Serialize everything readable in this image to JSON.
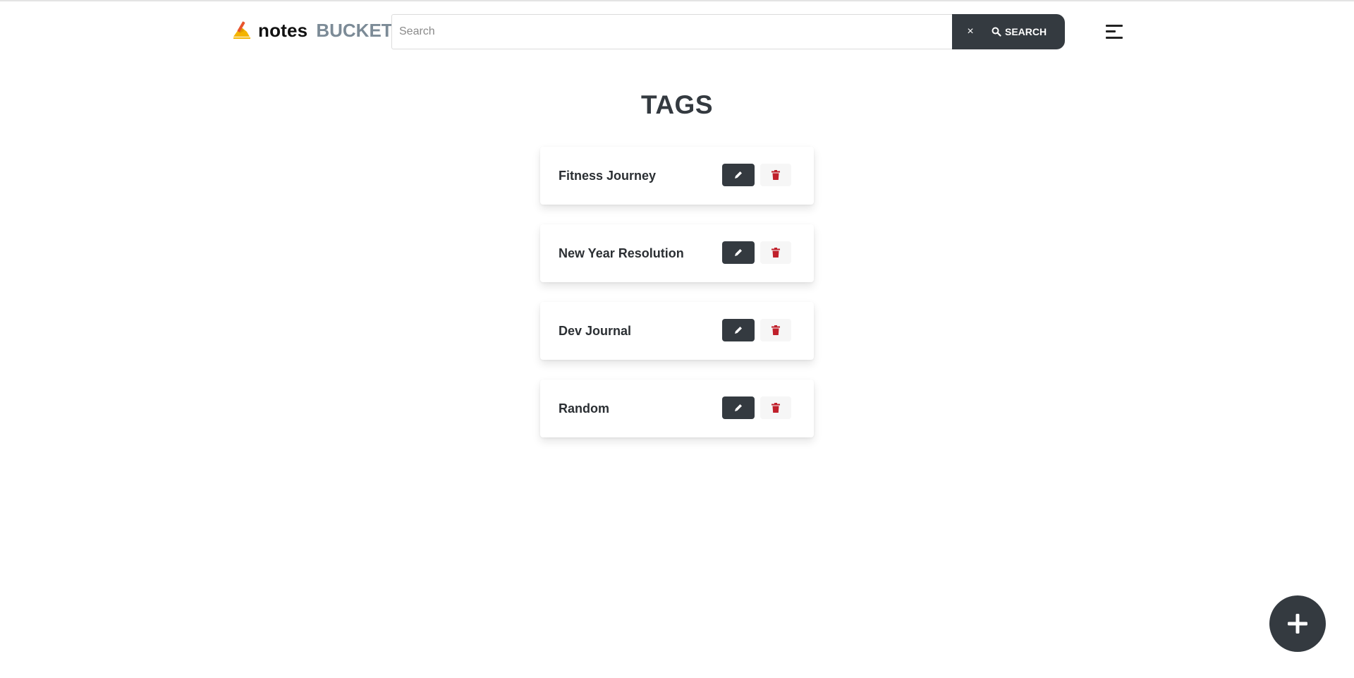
{
  "brand": {
    "icon": "writing-hand-icon",
    "name_primary": "notes",
    "name_secondary": "BUCKET"
  },
  "search": {
    "placeholder": "Search",
    "value": "",
    "clear_label": "×",
    "button_label": "SEARCH",
    "button_icon": "search-icon"
  },
  "menu": {
    "icon": "menu-icon"
  },
  "page": {
    "title": "TAGS"
  },
  "tags": [
    {
      "name": "Fitness Journey"
    },
    {
      "name": "New Year Resolution"
    },
    {
      "name": "Dev Journal"
    },
    {
      "name": "Random"
    }
  ],
  "actions": {
    "edit_icon": "pencil-icon",
    "delete_icon": "trash-icon",
    "add_icon": "plus-icon"
  },
  "colors": {
    "dark": "#343a40",
    "accent_muted": "#7c8b97",
    "danger": "#c0202b"
  }
}
